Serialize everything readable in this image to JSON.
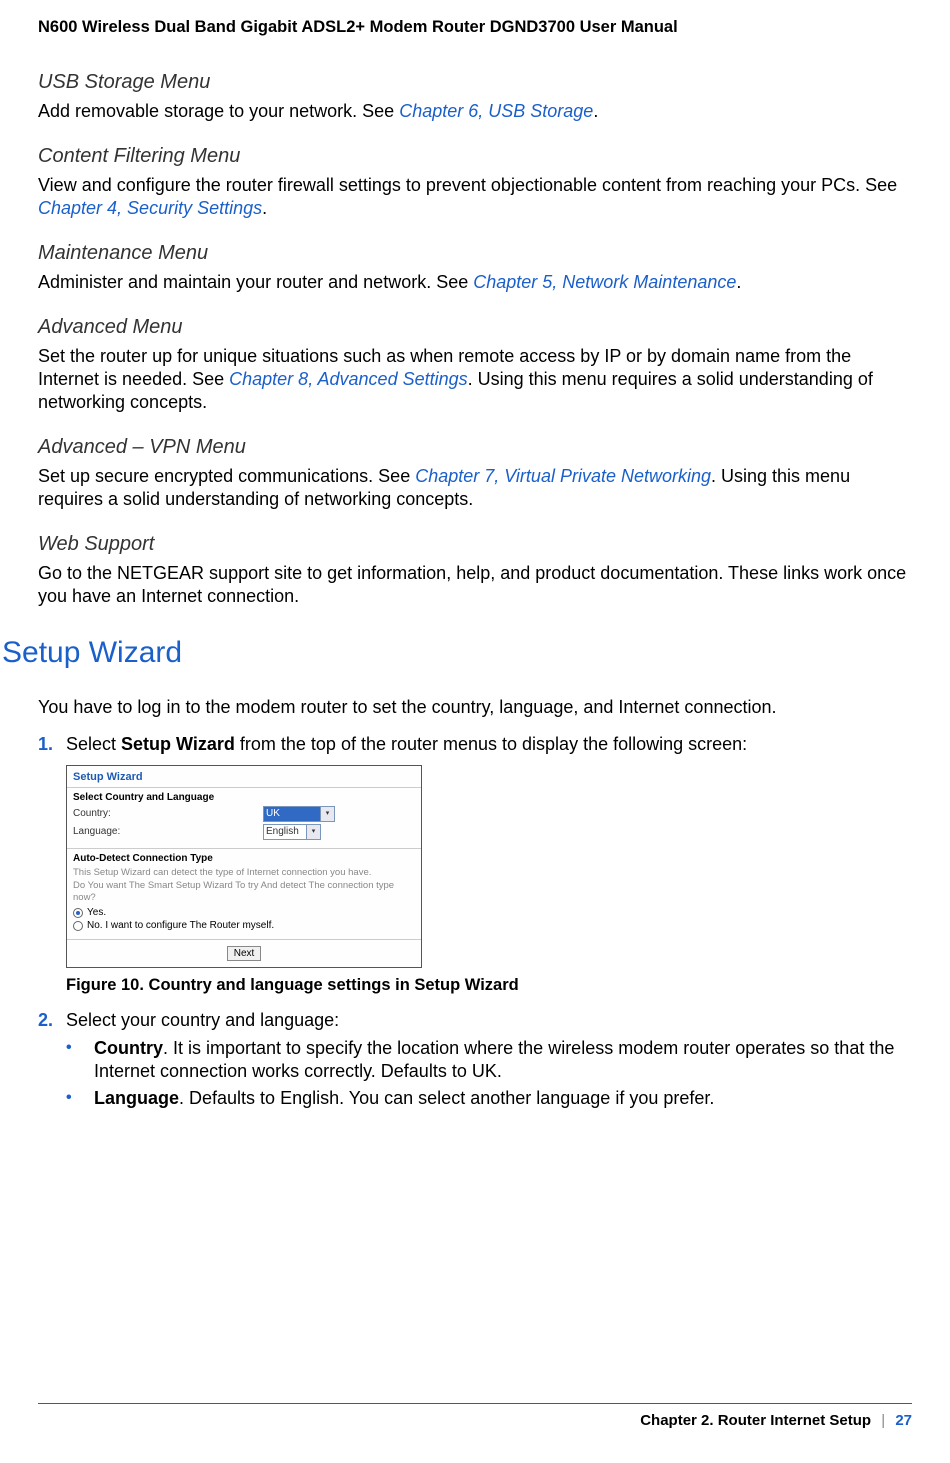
{
  "header": {
    "title": "N600 Wireless Dual Band Gigabit ADSL2+ Modem Router DGND3700 User Manual"
  },
  "sections": {
    "usb": {
      "heading": "USB Storage Menu",
      "text_a": "Add removable storage to your network. See ",
      "link": "Chapter 6, USB Storage",
      "text_b": "."
    },
    "cf": {
      "heading": "Content Filtering Menu",
      "text_a": "View and configure the router firewall settings to prevent objectionable content from reaching your PCs. See ",
      "link": "Chapter 4, Security Settings",
      "text_b": "."
    },
    "mt": {
      "heading": "Maintenance Menu",
      "text_a": "Administer and maintain your router and network. See ",
      "link": "Chapter 5, Network Maintenance",
      "text_b": "."
    },
    "adv": {
      "heading": "Advanced Menu",
      "text_a": "Set the router up for unique situations such as when remote access by IP or by domain name from the Internet is needed. See ",
      "link": "Chapter 8, Advanced Settings",
      "text_b": ". Using this menu requires a solid understanding of networking concepts."
    },
    "vpn": {
      "heading": "Advanced – VPN Menu",
      "text_a": "Set up secure encrypted communications. See ",
      "link": "Chapter 7, Virtual Private Networking",
      "text_b": ". Using this menu requires a solid understanding of networking concepts."
    },
    "web": {
      "heading": "Web Support",
      "text": "Go to the NETGEAR support site to get information, help, and product documentation. These links work once you have an Internet connection."
    }
  },
  "wizard": {
    "heading": "Setup Wizard",
    "intro": "You have to log in to the modem router to set the country, language, and Internet connection.",
    "step1": {
      "num": "1.",
      "a": "Select ",
      "bold": "Setup Wizard",
      "b": " from the top of the router menus to display the following screen:"
    },
    "figure": {
      "title": "Setup Wizard",
      "sect1_hd": "Select Country and Language",
      "country_lbl": "Country:",
      "country_val": "UK",
      "lang_lbl": "Language:",
      "lang_val": "English",
      "sect2_hd": "Auto-Detect Connection Type",
      "line1": "This Setup Wizard can detect the type of Internet connection you have.",
      "line2": "Do You want The Smart Setup Wizard To try And detect The connection type now?",
      "opt_yes": "Yes.",
      "opt_no": "No. I want to configure The Router myself.",
      "btn": "Next",
      "caption": "Figure 10.  Country and language settings in Setup Wizard"
    },
    "step2": {
      "num": "2.",
      "text": "Select your country and language:",
      "b1": {
        "bold": "Country",
        "rest": ". It is important to specify the location where the wireless modem router operates so that the Internet connection works correctly. Defaults to UK."
      },
      "b2": {
        "bold": "Language",
        "rest": ". Defaults to English. You can select another language if you prefer."
      }
    }
  },
  "footer": {
    "chapter": "Chapter 2.  Router Internet Setup",
    "divider": "|",
    "page": "27"
  }
}
